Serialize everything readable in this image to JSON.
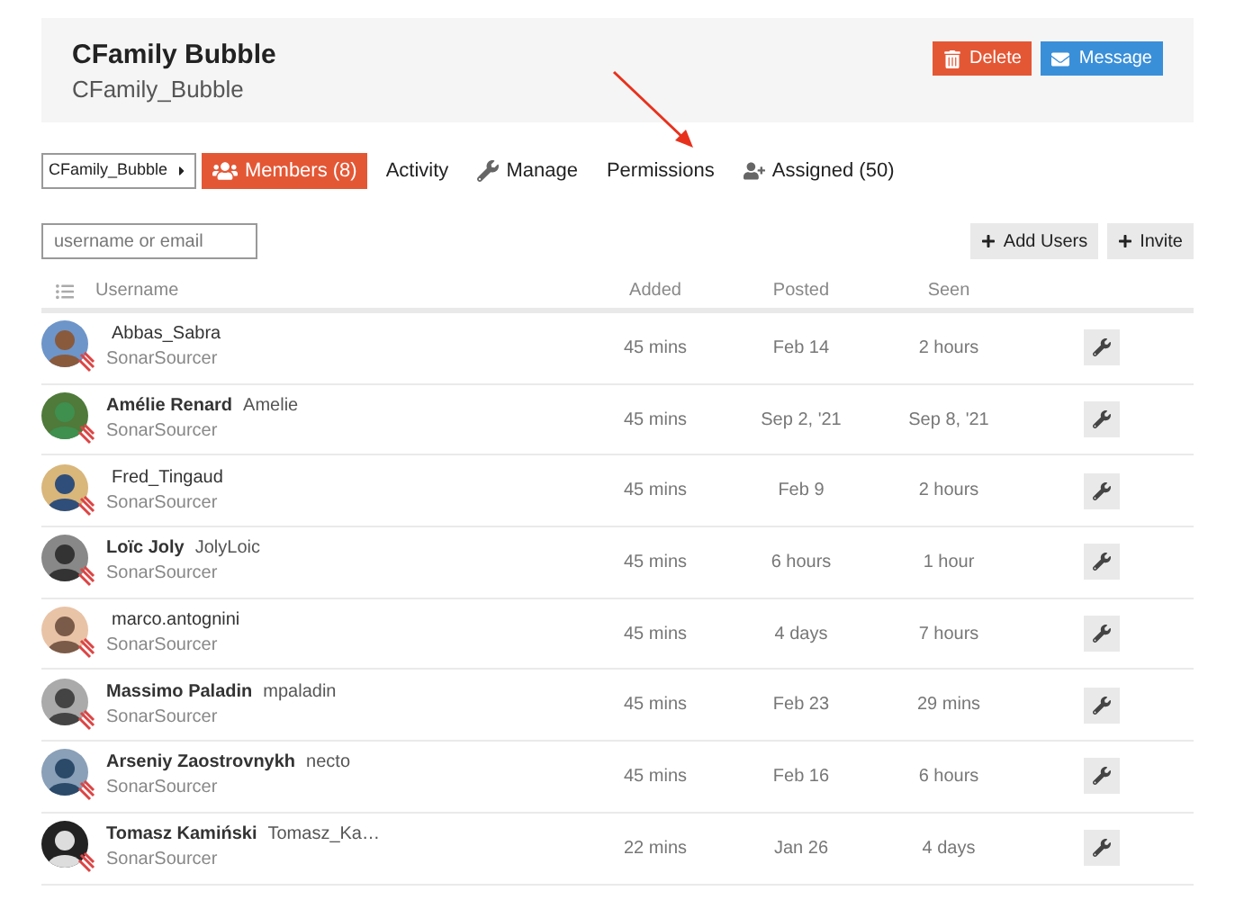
{
  "group": {
    "title": "CFamily Bubble",
    "subtitle": "CFamily_Bubble"
  },
  "actions": [
    {
      "label": "Delete",
      "kind": "danger"
    },
    {
      "label": "Message",
      "kind": "primary"
    }
  ],
  "group_switcher": {
    "label": "CFamily_Bubble"
  },
  "tabs": [
    {
      "label": "Members (8)",
      "kind": "users",
      "selected": true
    },
    {
      "label": "Activity",
      "kind": "plain",
      "selected": false
    },
    {
      "label": "Manage",
      "kind": "wrench",
      "selected": false
    },
    {
      "label": "Permissions",
      "kind": "plain",
      "selected": false
    },
    {
      "label": "Assigned (50)",
      "kind": "user-plus",
      "selected": false
    }
  ],
  "search": {
    "placeholder": "username or email"
  },
  "toolbar": [
    "Add Users",
    "Invite"
  ],
  "table": {
    "columns": [
      "Username",
      "Added",
      "Posted",
      "Seen"
    ],
    "rows": [
      {
        "username": "Abbas_Sabra",
        "group": "SonarSourcer",
        "added": "45 mins",
        "posted": "Feb 14",
        "seen": "2 hours"
      },
      {
        "name": "Amélie Renard",
        "username": "Amelie",
        "group": "SonarSourcer",
        "added": "45 mins",
        "posted": "Sep 2, '21",
        "seen": "Sep 8, '21"
      },
      {
        "username": "Fred_Tingaud",
        "group": "SonarSourcer",
        "added": "45 mins",
        "posted": "Feb 9",
        "seen": "2 hours"
      },
      {
        "name": "Loïc Joly",
        "username": "JolyLoic",
        "group": "SonarSourcer",
        "added": "45 mins",
        "posted": "6 hours",
        "seen": "1 hour"
      },
      {
        "username": "marco.antognini",
        "group": "SonarSourcer",
        "added": "45 mins",
        "posted": "4 days",
        "seen": "7 hours"
      },
      {
        "name": "Massimo Paladin",
        "username": "mpaladin",
        "group": "SonarSourcer",
        "added": "45 mins",
        "posted": "Feb 23",
        "seen": "29 mins"
      },
      {
        "name": "Arseniy Zaostrovnykh",
        "username": "necto",
        "group": "SonarSourcer",
        "added": "45 mins",
        "posted": "Feb 16",
        "seen": "6 hours"
      },
      {
        "name": "Tomasz Kamiński",
        "username": "Tomasz_Ka…",
        "group": "SonarSourcer",
        "added": "22 mins",
        "posted": "Jan 26",
        "seen": "4 days"
      }
    ]
  }
}
